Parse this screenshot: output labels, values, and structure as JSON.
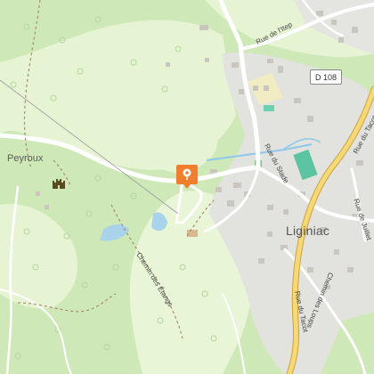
{
  "map": {
    "places": {
      "peyroux": "Peyroux",
      "liginiac": "Liginiac"
    },
    "streets": {
      "rue_de_litep": "Rue de l'Itep",
      "rue_du_stade": "Rue du Stade",
      "rue_du_tacot_north": "Rue du Tacot",
      "rue_du_tacot_south": "Rue du Tacot",
      "rue_de_juillet": "Rue de Juillet",
      "chemin_des_etangs": "Chemin des Étangs",
      "chemin_des_loups": "Chemin des Loups"
    },
    "route_badge": "D 108",
    "pin_icon": "map-marker-icon",
    "castle_icon": "castle-icon",
    "colors": {
      "forest": "#cfe8b8",
      "meadow": "#e8f5d6",
      "town": "#e2e2de",
      "water": "#a9d3ea",
      "major_road": "#f6d876",
      "pin": "#f07e2c"
    }
  }
}
